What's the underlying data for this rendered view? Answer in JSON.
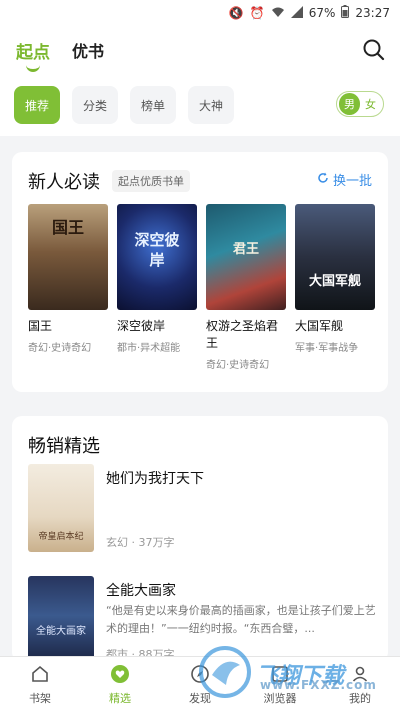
{
  "status_bar": {
    "battery": "67%",
    "time": "23:27"
  },
  "top_nav": {
    "tabs": [
      "起点",
      "优书"
    ],
    "active_tab": "起点"
  },
  "filters": {
    "chips": [
      "推荐",
      "分类",
      "榜单",
      "大神"
    ],
    "active": "推荐"
  },
  "gender_toggle": {
    "male": "男",
    "female": "女",
    "selected": "男"
  },
  "section_new": {
    "title": "新人必读",
    "badge": "起点优质书单",
    "refresh_label": "换一批",
    "books": [
      {
        "title": "国王",
        "tags": "奇幻·史诗奇幻",
        "cover_text": "国王"
      },
      {
        "title": "深空彼岸",
        "tags": "都市·异术超能",
        "cover_text": "深空彼岸"
      },
      {
        "title": "权游之圣焰君王",
        "tags": "奇幻·史诗奇幻",
        "cover_text": "君王"
      },
      {
        "title": "大国军舰",
        "tags": "军事·军事战争",
        "cover_text": "大国军舰"
      }
    ]
  },
  "section_hot": {
    "title": "畅销精选",
    "items": [
      {
        "title": "她们为我打天下",
        "desc": "",
        "meta": "玄幻 · 37万字",
        "cover_text": "帝皇启本纪"
      },
      {
        "title": "全能大画家",
        "desc": "“他是有史以来身价最高的插画家，也是让孩子们爱上艺术的理由！”一一纽约时报。“东西合璧，...",
        "meta": "都市 · 88万字",
        "cover_text": "全能大画家"
      }
    ]
  },
  "bottom_nav": {
    "items": [
      {
        "label": "书架",
        "icon": "home-icon"
      },
      {
        "label": "精选",
        "icon": "heart-icon"
      },
      {
        "label": "发现",
        "icon": "discover-icon"
      },
      {
        "label": "浏览器",
        "icon": "browser-icon"
      },
      {
        "label": "我的",
        "icon": "user-icon"
      }
    ],
    "active": "精选"
  },
  "watermark": {
    "text": "飞翔下载",
    "url": "www.FXXZ.com"
  },
  "colors": {
    "accent": "#80bf36",
    "link": "#3a8ee6"
  }
}
